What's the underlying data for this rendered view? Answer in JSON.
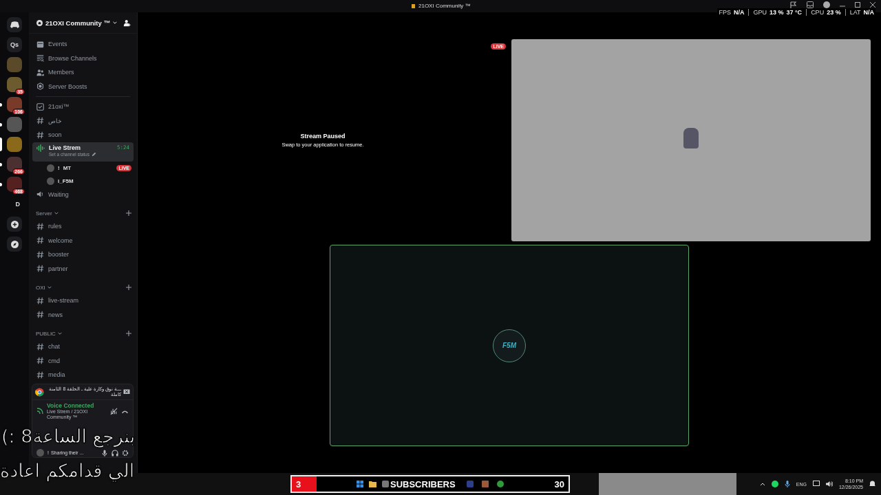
{
  "window": {
    "title": "21OXI Community ™"
  },
  "perf_overlay": [
    {
      "label": "FPS",
      "values": [
        "N/A"
      ]
    },
    {
      "label": "GPU",
      "values": [
        "13 %",
        "37 °C"
      ]
    },
    {
      "label": "CPU",
      "values": [
        "23 %"
      ]
    },
    {
      "label": "LAT",
      "values": [
        "N/A"
      ]
    }
  ],
  "servers": [
    {
      "kind": "home",
      "selected": false,
      "unread": false
    },
    {
      "kind": "text",
      "label": "Qs",
      "selected": false,
      "unread": false
    },
    {
      "kind": "image",
      "selected": false,
      "unread": false
    },
    {
      "kind": "image",
      "badge": "35",
      "selected": false,
      "unread": false
    },
    {
      "kind": "image",
      "badge": "106",
      "selected": false,
      "unread": true
    },
    {
      "kind": "image",
      "selected": false,
      "unread": true
    },
    {
      "kind": "image",
      "selected": true,
      "unread": false
    },
    {
      "kind": "image",
      "badge": "266",
      "selected": false,
      "unread": true
    },
    {
      "kind": "image",
      "badge": "468",
      "selected": false,
      "unread": true
    },
    {
      "kind": "folder",
      "label": "D",
      "selected": false,
      "unread": false
    },
    {
      "kind": "add",
      "selected": false,
      "unread": false
    },
    {
      "kind": "discover",
      "selected": false,
      "unread": false
    }
  ],
  "server": {
    "name": "21OXI Community ™"
  },
  "menu": [
    {
      "kind": "events",
      "label": "Events"
    },
    {
      "kind": "browse",
      "label": "Browse Channels"
    },
    {
      "kind": "members",
      "label": "Members"
    },
    {
      "kind": "boosts",
      "label": "Server Boosts"
    }
  ],
  "channels": [
    {
      "kind": "checklist",
      "name": "21oxi™",
      "selected": false
    },
    {
      "kind": "text",
      "name": "خاص",
      "selected": false
    },
    {
      "kind": "text",
      "name": "soon",
      "selected": false
    },
    {
      "kind": "voice",
      "name": "Live Strem",
      "selected": true,
      "status": "Set a channel status",
      "timer": "5:24",
      "members": [
        {
          "prefix": "!",
          "name": "MT",
          "live": true,
          "badge": "LIVE"
        },
        {
          "name": "i_F5M",
          "live": false
        }
      ]
    },
    {
      "kind": "voice",
      "name": "Waiting",
      "selected": false
    },
    {
      "kind": "category",
      "name": "Server",
      "expanded": true,
      "children": [
        {
          "kind": "text",
          "name": "rules",
          "selected": false
        },
        {
          "kind": "text",
          "name": "welcome",
          "selected": false
        },
        {
          "kind": "text",
          "name": "booster",
          "selected": false
        },
        {
          "kind": "text",
          "name": "partner",
          "selected": false
        }
      ]
    },
    {
      "kind": "category",
      "name": "OXI",
      "expanded": true,
      "children": [
        {
          "kind": "text",
          "name": "live-stream",
          "selected": false
        },
        {
          "kind": "text",
          "name": "news",
          "selected": false
        }
      ]
    },
    {
      "kind": "category",
      "name": "PUBLIC",
      "expanded": true,
      "children": [
        {
          "kind": "text",
          "name": "chat",
          "selected": false
        },
        {
          "kind": "text",
          "name": "cmd",
          "selected": false
        },
        {
          "kind": "text",
          "name": "media",
          "selected": false
        }
      ]
    }
  ],
  "activity": {
    "title": "ـــة نوق وكارة علية ـ الحلقة 8 الثامنة كاملة"
  },
  "voice_status": {
    "title": "Voice Connected",
    "channel": "Live Strem / 21OXI Community ™"
  },
  "user": {
    "name": "!",
    "status": "Sharing their ..."
  },
  "stage": {
    "paused_title": "Stream Paused",
    "paused_hint": "Swap to your application to resume.",
    "live_badge": "LIVE",
    "logo_text": "F5M"
  },
  "taskbar": {
    "subscribers": {
      "count": "3",
      "label": "SUBSCRIBERS",
      "goal": "30"
    },
    "language": "ENG",
    "time": "8:10 PM",
    "date": "12/26/2025"
  },
  "caption": [
    "بنرجع الساعة8 :)",
    "الي قدامكم اعادة"
  ]
}
